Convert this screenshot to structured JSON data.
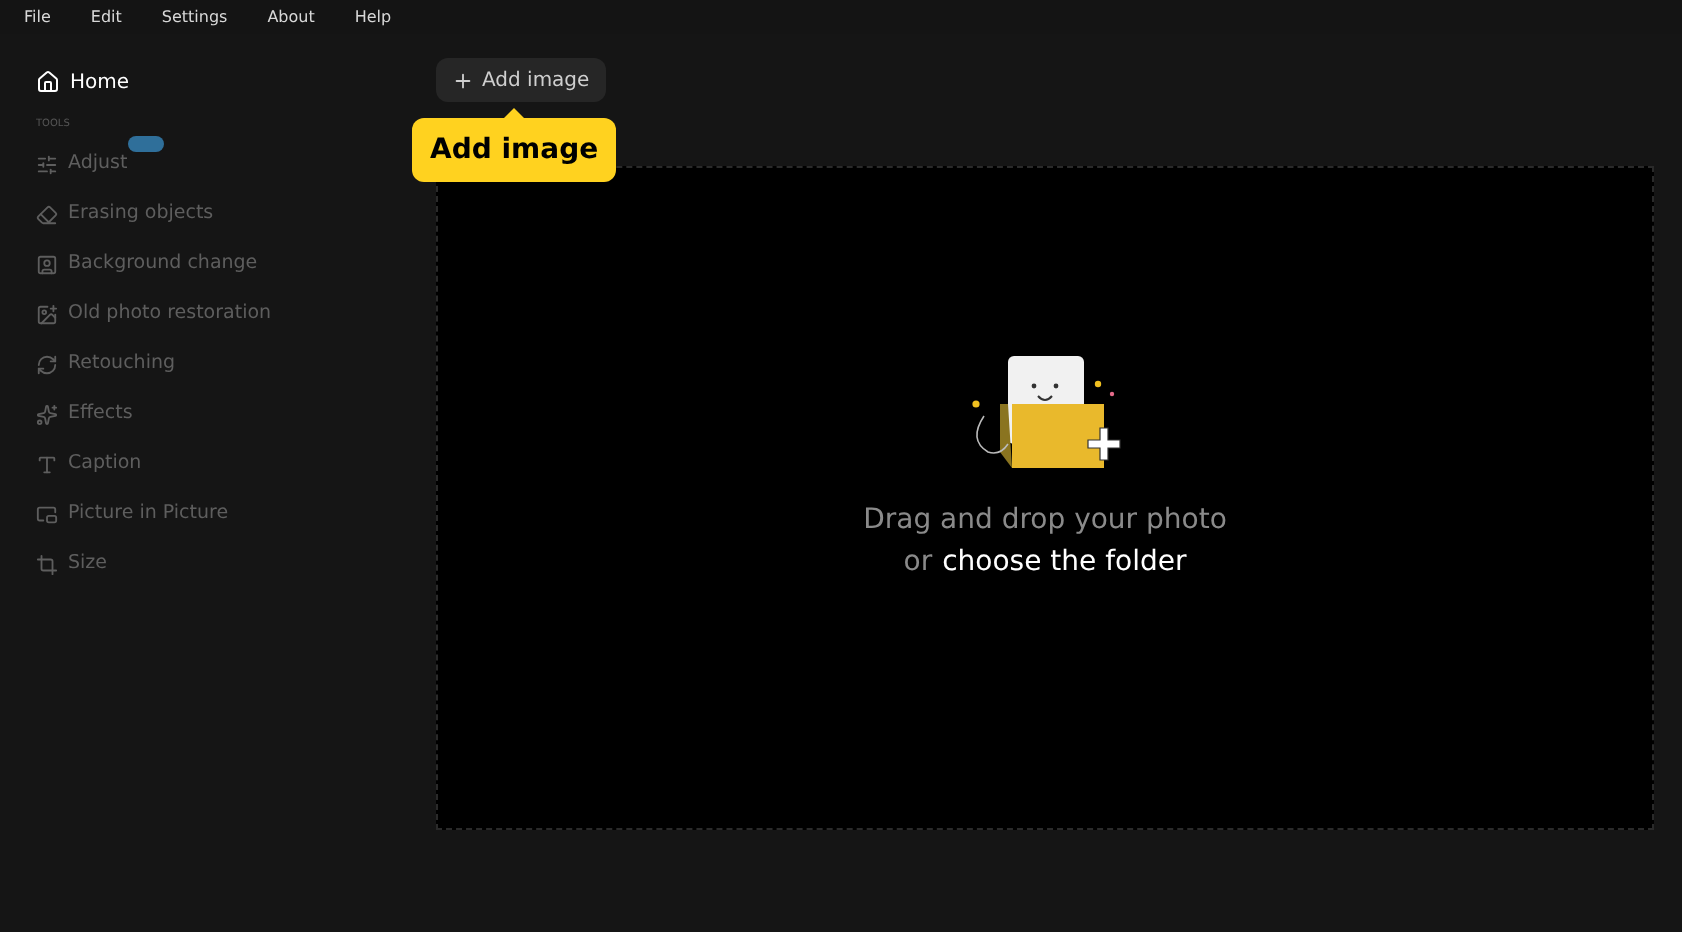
{
  "menu": [
    "File",
    "Edit",
    "Settings",
    "About",
    "Help"
  ],
  "sidebar": {
    "home": {
      "label": "Home",
      "selected": true
    },
    "section": "TOOLS",
    "items": [
      {
        "label": "Adjust",
        "badge": true,
        "disabled": true
      },
      {
        "label": "Erasing objects",
        "badge": false,
        "disabled": true
      },
      {
        "label": "Background change",
        "badge": false,
        "disabled": true
      },
      {
        "label": "Old photo restoration",
        "badge": false,
        "disabled": true
      },
      {
        "label": "Retouching",
        "badge": false,
        "disabled": true
      },
      {
        "label": "Effects",
        "badge": false,
        "disabled": true
      },
      {
        "label": "Caption",
        "badge": false,
        "disabled": true
      },
      {
        "label": "Picture in Picture",
        "badge": false,
        "disabled": true
      },
      {
        "label": "Size",
        "badge": false,
        "disabled": true
      }
    ]
  },
  "toolbar": {
    "add_button": "Add image",
    "tooltip": "Add image"
  },
  "dropzone": {
    "line1": "Drag and drop your photo",
    "line2_prefix": "or",
    "line2_link": "choose the folder"
  }
}
